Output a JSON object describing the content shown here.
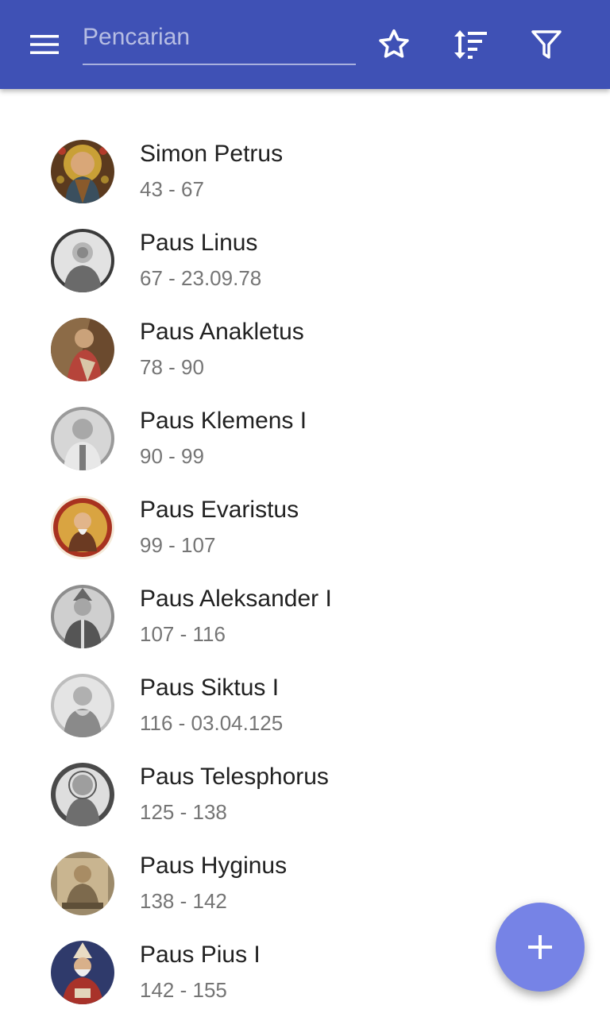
{
  "toolbar": {
    "menu_icon": "hamburger-menu-icon",
    "search_placeholder": "Pencarian",
    "search_value": "",
    "favorite_icon": "star-outline-icon",
    "sort_icon": "sort-icon",
    "filter_icon": "filter-icon",
    "background_color": "#3f51b5"
  },
  "popes": [
    {
      "name": "Simon Petrus",
      "years": "43 - 67",
      "portrait": "color"
    },
    {
      "name": "Paus Linus",
      "years": "67 - 23.09.78",
      "portrait": "engraving"
    },
    {
      "name": "Paus Anakletus",
      "years": "78 - 90",
      "portrait": "color"
    },
    {
      "name": "Paus Klemens I",
      "years": "90 - 99",
      "portrait": "engraving"
    },
    {
      "name": "Paus Evaristus",
      "years": "99 - 107",
      "portrait": "medallion"
    },
    {
      "name": "Paus Aleksander I",
      "years": "107 - 116",
      "portrait": "engraving"
    },
    {
      "name": "Paus Siktus I",
      "years": "116 - 03.04.125",
      "portrait": "engraving"
    },
    {
      "name": "Paus Telesphorus",
      "years": "125 - 138",
      "portrait": "engraving"
    },
    {
      "name": "Paus Hyginus",
      "years": "138 - 142",
      "portrait": "sepia"
    },
    {
      "name": "Paus Pius I",
      "years": "142 - 155",
      "portrait": "color"
    }
  ],
  "fab": {
    "icon": "plus-icon",
    "color": "#7683e6"
  }
}
